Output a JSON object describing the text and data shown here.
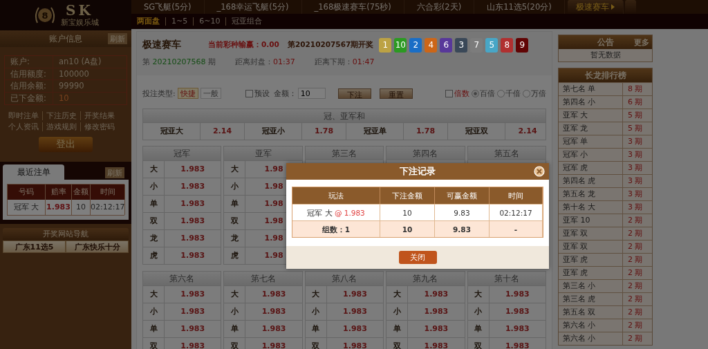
{
  "logo": {
    "ball": "8",
    "title": "SK",
    "subtitle": "新宝娱乐城"
  },
  "game_tabs": [
    {
      "label": "SG飞艇(5分)",
      "selected": false
    },
    {
      "label": "_168幸运飞艇(5分)",
      "selected": false
    },
    {
      "label": "_168极速赛车(75秒)",
      "selected": false
    },
    {
      "label": "六合彩(2天)",
      "selected": false
    },
    {
      "label": "山东11选5(20分)",
      "selected": false
    },
    {
      "label": "极速赛车",
      "selected": true
    }
  ],
  "sub_tabs": [
    {
      "label": "两面盘",
      "selected": true
    },
    {
      "label": "1~5",
      "selected": false
    },
    {
      "label": "6~10",
      "selected": false
    },
    {
      "label": "冠亚组合",
      "selected": false
    }
  ],
  "account": {
    "title": "账户信息",
    "refresh": "刷新",
    "rows": [
      {
        "label": "账户:",
        "value": "an10 (A盘)",
        "highlight": false
      },
      {
        "label": "信用额度:",
        "value": "100000",
        "highlight": false
      },
      {
        "label": "信用余额:",
        "value": "99990",
        "highlight": false
      },
      {
        "label": "已下金额:",
        "value": "10",
        "highlight": true
      }
    ],
    "links": [
      [
        "即时注单",
        "下注历史",
        "开奖结果"
      ],
      [
        "个人资讯",
        "游戏规则",
        "修改密码"
      ]
    ],
    "logout": "登出"
  },
  "recent": {
    "tabs": [
      {
        "label": "最近注单",
        "selected": true
      }
    ],
    "refresh": "刷新",
    "columns": [
      "号码",
      "赔率",
      "金额",
      "时间"
    ],
    "rows": [
      [
        "冠军 大",
        "1.983",
        "10",
        "02:12:17"
      ]
    ]
  },
  "site_nav": {
    "title": "开奖网站导航",
    "links": [
      "广东11选5",
      "广东快乐十分"
    ]
  },
  "game": {
    "title": "极速赛车",
    "profit_label": "当前彩种输赢：",
    "profit": "0.00",
    "draw_label": "第20210207567期开奖",
    "balls": [
      {
        "number": "1",
        "color": "#bca244"
      },
      {
        "number": "10",
        "color": "#2c9a22"
      },
      {
        "number": "2",
        "color": "#1a6ec6"
      },
      {
        "number": "4",
        "color": "#cc6618"
      },
      {
        "number": "6",
        "color": "#58389a"
      },
      {
        "number": "3",
        "color": "#3a4858"
      },
      {
        "number": "7",
        "color": "#7c7c7c"
      },
      {
        "number": "5",
        "color": "#48a6c6"
      },
      {
        "number": "8",
        "color": "#b03030"
      },
      {
        "number": "9",
        "color": "#600404"
      }
    ],
    "period_prefix": "第",
    "period": "20210207568",
    "period_suffix": "期",
    "close_label": "距离封盘：",
    "close_time": "01:37",
    "next_label": "距离下期：",
    "next_time": "01:47"
  },
  "bet_bar": {
    "type_label": "投注类型:",
    "types": [
      {
        "label": "快捷",
        "selected": true
      },
      {
        "label": "一般",
        "selected": false
      }
    ],
    "preset": {
      "label": "预设",
      "checked": false
    },
    "amount_label": "金额：",
    "amount": "10",
    "submit": "下注",
    "reset": "重置",
    "multiple": {
      "label": "倍数",
      "checked": false
    },
    "scales": [
      {
        "label": "百倍",
        "selected": true
      },
      {
        "label": "千倍",
        "selected": false
      },
      {
        "label": "万倍",
        "selected": false
      }
    ]
  },
  "sum_table": {
    "title": "冠、亚军和",
    "cells": [
      {
        "label": "冠亚大",
        "odds": "2.14"
      },
      {
        "label": "冠亚小",
        "odds": "1.78"
      },
      {
        "label": "冠亚单",
        "odds": "1.78"
      },
      {
        "label": "冠亚双",
        "odds": "2.14"
      }
    ]
  },
  "boards": [
    {
      "title": "冠军",
      "rows": [
        {
          "label": "大",
          "odds": "1.983"
        },
        {
          "label": "小",
          "odds": "1.983"
        },
        {
          "label": "单",
          "odds": "1.983"
        },
        {
          "label": "双",
          "odds": "1.983"
        },
        {
          "label": "龙",
          "odds": "1.983"
        },
        {
          "label": "虎",
          "odds": "1.983"
        }
      ]
    },
    {
      "title": "亚军",
      "rows": [
        {
          "label": "大",
          "odds": "1.98"
        },
        {
          "label": "小",
          "odds": "1.98"
        },
        {
          "label": "单",
          "odds": "1.98"
        },
        {
          "label": "双",
          "odds": "1.98"
        },
        {
          "label": "龙",
          "odds": "1.98"
        },
        {
          "label": "虎",
          "odds": "1.98"
        }
      ]
    },
    {
      "title": "第三名"
    },
    {
      "title": "第四名"
    },
    {
      "title": "第五名"
    },
    {
      "title": "第六名",
      "rows": [
        {
          "label": "大",
          "odds": "1.983"
        },
        {
          "label": "小",
          "odds": "1.983"
        },
        {
          "label": "单",
          "odds": "1.983"
        },
        {
          "label": "双",
          "odds": "1.983"
        }
      ]
    },
    {
      "title": "第七名",
      "rows": [
        {
          "label": "大",
          "odds": "1.983"
        },
        {
          "label": "小",
          "odds": "1.983"
        },
        {
          "label": "单",
          "odds": "1.983"
        },
        {
          "label": "双",
          "odds": "1.983"
        }
      ]
    },
    {
      "title": "第八名",
      "rows": [
        {
          "label": "大",
          "odds": "1.983"
        },
        {
          "label": "小",
          "odds": "1.983"
        },
        {
          "label": "单",
          "odds": "1.983"
        },
        {
          "label": "双",
          "odds": "1.983"
        }
      ]
    },
    {
      "title": "第九名",
      "rows": [
        {
          "label": "大",
          "odds": "1.983"
        },
        {
          "label": "小",
          "odds": "1.983"
        },
        {
          "label": "单",
          "odds": "1.983"
        },
        {
          "label": "双",
          "odds": "1.983"
        }
      ]
    },
    {
      "title": "第十名",
      "rows": [
        {
          "label": "大",
          "odds": "1.983"
        },
        {
          "label": "小",
          "odds": "1.983"
        },
        {
          "label": "单",
          "odds": "1.983"
        },
        {
          "label": "双",
          "odds": "1.983"
        }
      ]
    }
  ],
  "notice": {
    "title": "公告",
    "more": "更多",
    "text": "暂无数据"
  },
  "long_dragon": {
    "title": "长龙排行榜",
    "rows": [
      {
        "name": "第七名 单",
        "count": "8 期"
      },
      {
        "name": "第四名 小",
        "count": "6 期"
      },
      {
        "name": "亚军 大",
        "count": "5 期"
      },
      {
        "name": "亚军 龙",
        "count": "5 期"
      },
      {
        "name": "冠军 单",
        "count": "3 期"
      },
      {
        "name": "冠军 小",
        "count": "3 期"
      },
      {
        "name": "冠军 虎",
        "count": "3 期"
      },
      {
        "name": "第四名 虎",
        "count": "3 期"
      },
      {
        "name": "第五名 龙",
        "count": "3 期"
      },
      {
        "name": "第十名 大",
        "count": "3 期"
      },
      {
        "name": "亚军 10",
        "count": "2 期"
      },
      {
        "name": "亚军 双",
        "count": "2 期"
      },
      {
        "name": "亚军 双",
        "count": "2 期"
      },
      {
        "name": "亚军 虎",
        "count": "2 期"
      },
      {
        "name": "亚军 虎",
        "count": "2 期"
      },
      {
        "name": "第三名 小",
        "count": "2 期"
      },
      {
        "name": "第三名 虎",
        "count": "2 期"
      },
      {
        "name": "第五名 双",
        "count": "2 期"
      },
      {
        "name": "第六名 小",
        "count": "2 期"
      },
      {
        "name": "第六名 小",
        "count": "2 期"
      }
    ]
  },
  "dialog": {
    "title": "下注记录",
    "columns": [
      "玩法",
      "下注金额",
      "可赢金额",
      "时间"
    ],
    "rows": [
      {
        "play": "冠军 大",
        "odds": "@ 1.983",
        "amount": "10",
        "win": "9.83",
        "time": "02:12:17"
      }
    ],
    "summary": [
      "组数：1",
      "10",
      "9.83",
      "-"
    ],
    "close": "关闭"
  }
}
